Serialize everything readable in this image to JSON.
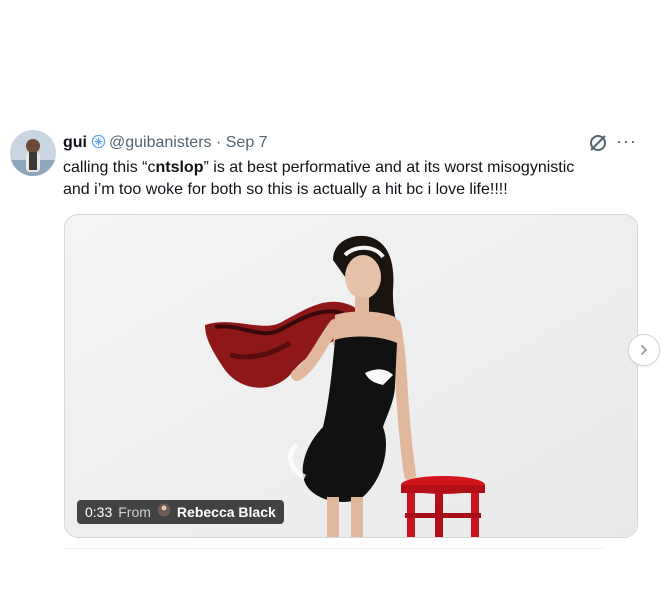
{
  "tweet": {
    "author_name": "gui",
    "handle": "@guibanisters",
    "separator": "·",
    "date": "Sep 7",
    "text_line1_pre": "calling this “c",
    "text_line1_bold": "ntslop",
    "text_line1_post": "” is at best performative and at its worst misogynistic",
    "text_line2": "and i’m too woke for both so this is actually a hit bc i love life!!!!",
    "more_label": "···"
  },
  "video": {
    "timestamp": "0:33",
    "from_label": "From",
    "source_name": "Rebecca Black"
  },
  "icons": {
    "verified": "verified-badge-icon",
    "grok": "grok-slash-icon",
    "more": "more-options-icon",
    "next": "chevron-right-icon"
  },
  "colors": {
    "text": "#0f1419",
    "secondary": "#536471",
    "badge": "#6aa7e8",
    "fur": "#9e1c1c",
    "stool": "#c8141c"
  }
}
